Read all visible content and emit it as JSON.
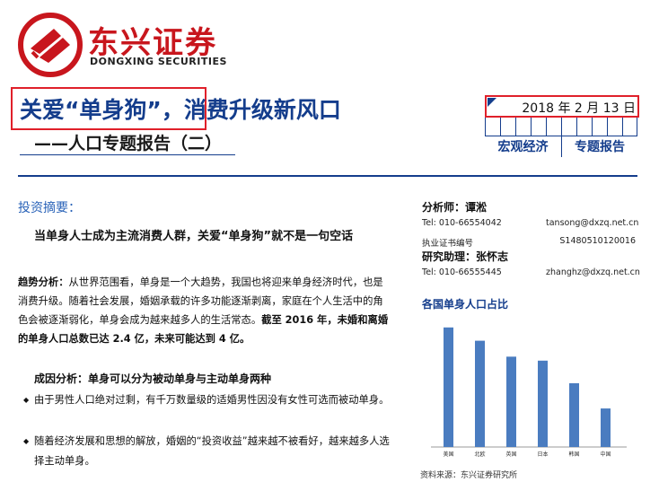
{
  "brand": {
    "name_cn": "东兴证券",
    "name_en": "DONGXING SECURITIES",
    "colors": {
      "red": "#c8161d",
      "navy": "#143d8c"
    }
  },
  "report": {
    "title_line1": "关爱“单身狗”，消费升级新风口",
    "title_line2": "——人口专题报告（二）",
    "date": "2018 年 2 月 13 日",
    "tags": [
      "宏观经济",
      "专题报告"
    ]
  },
  "summary": {
    "heading": "投资摘要：",
    "headline": "当单身人士成为主流消费人群，关爱“单身狗”就不是一句空话",
    "trend_label": "趋势分析：",
    "trend_text": "从世界范围看，单身是一个大趋势，我国也将迎来单身经济时代，也是消费升级。随着社会发展，婚姻承载的许多功能逐渐剥离，家庭在个人生活中的角色会被逐渐弱化，单身会成为越来越多人的生活常态。",
    "trend_bold": "截至 2016 年，未婚和离婚的单身人口总数已达 2.4 亿，未来可能达到 4 亿。",
    "cause_heading": "成因分析：单身可以分为被动单身与主动单身两种",
    "bullets": [
      "由于男性人口绝对过剩，有千万数量级的适婚男性因没有女性可选而被动单身。",
      "随着经济发展和思想的解放，婚姻的“投资收益”越来越不被看好，越来越多人选择主动单身。"
    ]
  },
  "analysts": {
    "analyst_label": "分析师：谭淞",
    "analyst_tel": "Tel:  010-66554042",
    "analyst_email": "tansong@dxzq.net.cn",
    "license_label": "执业证书编号",
    "license_no": "S1480510120016",
    "assistant_label": "研究助理：张怀志",
    "assistant_tel": "Tel:  010-66555445",
    "assistant_email": "zhanghz@dxzq.net.cn"
  },
  "chart": {
    "title": "各国单身人口占比",
    "source": "资料来源：东兴证券研究所"
  },
  "chart_data": {
    "type": "bar",
    "title": "各国单身人口占比",
    "categories": [
      "美国",
      "北欧",
      "英国",
      "日本",
      "韩国",
      "中国"
    ],
    "values": [
      45,
      40,
      34,
      32.5,
      24,
      14.5
    ],
    "ylim": [
      0,
      50
    ],
    "grid": false,
    "color": "#4a7cc0"
  }
}
